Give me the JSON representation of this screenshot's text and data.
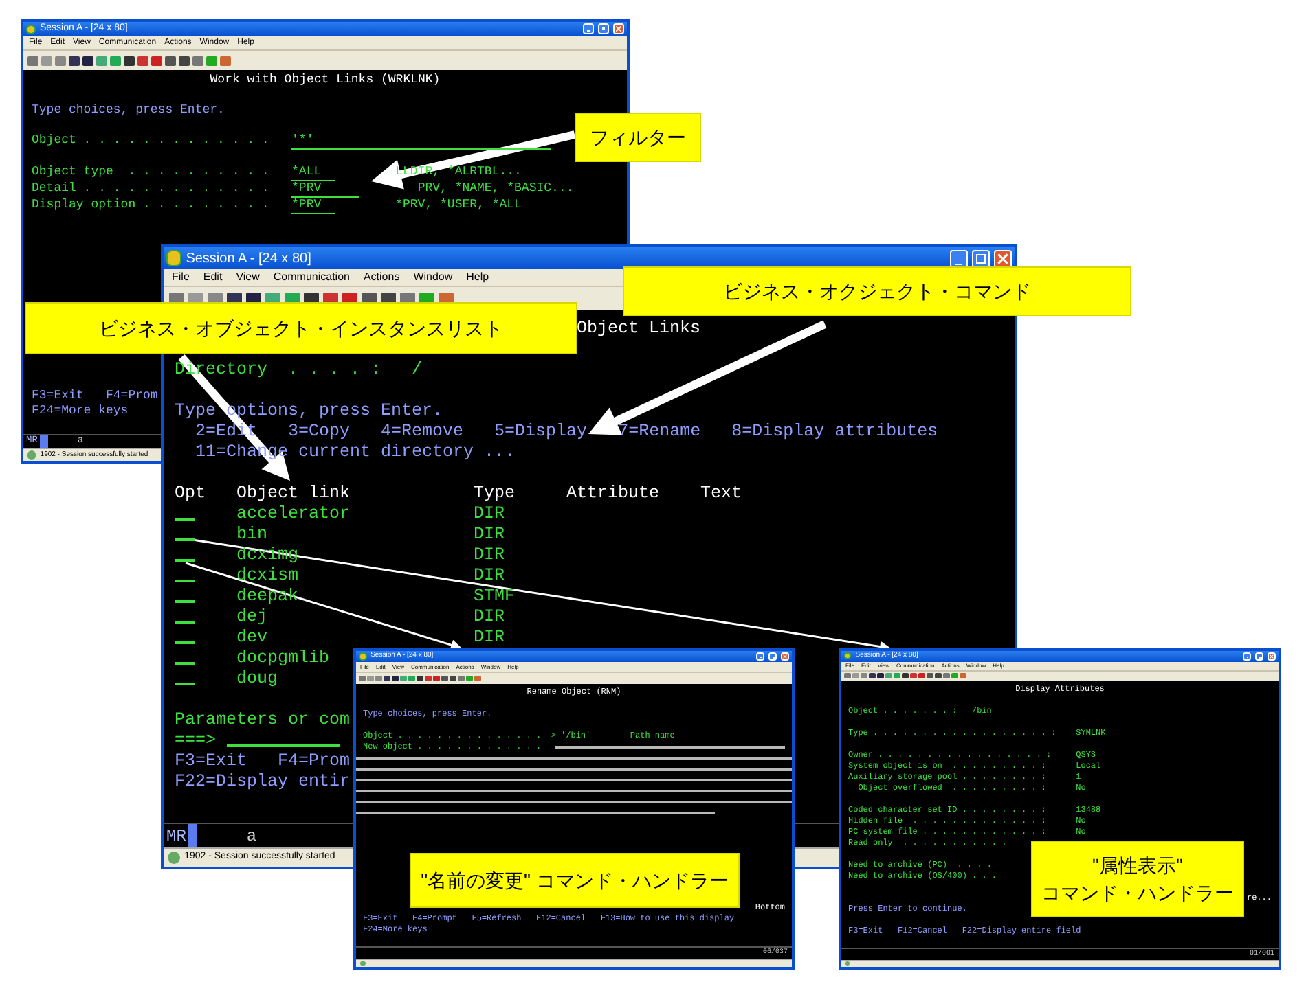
{
  "windows": [
    {
      "kind": "prompt",
      "title": "Session A - [24 x 80]",
      "menu": [
        "File",
        "Edit",
        "View",
        "Communication",
        "Actions",
        "Window",
        "Help"
      ],
      "heading": "Work with Object Links (WRKLNK)",
      "instruction": "Type choices, press Enter.",
      "fields": [
        {
          "label": "Object . . . . . . . . . . . . .",
          "value": "'*'"
        },
        {
          "label": "Object type  . . . . . . . . . .",
          "value": "*ALL",
          "choices": "LLDIR, *ALRTBL..."
        },
        {
          "label": "Detail . . . . . . . . . . . . .",
          "value": "*PRV",
          "choices": "PRV, *NAME, *BASIC..."
        },
        {
          "label": "Display option . . . . . . . . .",
          "value": "*PRV",
          "choices": "*PRV, *USER, *ALL"
        }
      ],
      "function_keys": [
        "F3=Exit   F4=Prom",
        "F24=More keys"
      ],
      "status": {
        "mode": "MR",
        "field": "a",
        "message": "1902 - Session successfully started"
      }
    },
    {
      "kind": "list",
      "title": "Session A - [24 x 80]",
      "menu": [
        "File",
        "Edit",
        "View",
        "Communication",
        "Actions",
        "Window",
        "Help"
      ],
      "heading": "Object Links",
      "directory": {
        "label": "Directory  . . . . :",
        "value": "/"
      },
      "instruction": "Type options, press Enter.",
      "options": [
        "2=Edit",
        "3=Copy",
        "4=Remove",
        "5=Display",
        "7=Rename",
        "8=Display attributes"
      ],
      "options_line2": "11=Change current directory ...",
      "columns": [
        "Opt",
        "Object link",
        "Type",
        "Attribute",
        "Text"
      ],
      "rows": [
        {
          "name": "accelerator",
          "type": "DIR"
        },
        {
          "name": "bin",
          "type": "DIR"
        },
        {
          "name": "dcximg",
          "type": "DIR"
        },
        {
          "name": "dcxism",
          "type": "DIR"
        },
        {
          "name": "deepak",
          "type": "STMF"
        },
        {
          "name": "dej",
          "type": "DIR"
        },
        {
          "name": "dev",
          "type": "DIR"
        },
        {
          "name": "docpgmlib"
        },
        {
          "name": "doug"
        }
      ],
      "command_label": "Parameters or com",
      "prompt": "===>",
      "function_keys": [
        "F3=Exit   F4=Prom",
        "F22=Display entir"
      ],
      "status": {
        "mode": "MR",
        "field": "a",
        "message": "1902 - Session successfully started"
      }
    },
    {
      "kind": "rename",
      "title": "Session A - [24 x 80]",
      "menu": [
        "File",
        "Edit",
        "View",
        "Communication",
        "Actions",
        "Window",
        "Help"
      ],
      "heading": "Rename Object (RNM)",
      "instruction": "Type choices, press Enter.",
      "fields": [
        {
          "label": "Object . . . . . . . . . . . . . . .",
          "value": "> '/bin'",
          "note": "Path name"
        },
        {
          "label": "New object . . . . . . . . . . . . ."
        }
      ],
      "bottom": "Bottom",
      "function_keys": [
        "F3=Exit   F4=Prompt   F5=Refresh   F12=Cancel   F13=How to use this display",
        "F24=More keys"
      ],
      "status": {
        "position": "06/037"
      }
    },
    {
      "kind": "attributes",
      "title": "Session A - [24 x 80]",
      "menu": [
        "File",
        "Edit",
        "View",
        "Communication",
        "Actions",
        "Window",
        "Help"
      ],
      "heading": "Display Attributes",
      "object": {
        "label": "Object . . . . . . . :",
        "value": "/bin"
      },
      "attribute_groups": [
        [
          {
            "label": "Type . . . . . . . . . . . . . . . . . . :",
            "value": "SYMLNK"
          }
        ],
        [
          {
            "label": "Owner . . . . . . . . . . . . . . . . . :",
            "value": "QSYS"
          },
          {
            "label": "System object is on  . . . . . . . . . :",
            "value": "Local"
          },
          {
            "label": "Auxiliary storage pool . . . . . . . . :",
            "value": "1"
          },
          {
            "label": "  Object overflowed  . . . . . . . . . :",
            "value": "No"
          }
        ],
        [
          {
            "label": "Coded character set ID . . . . . . . . :",
            "value": "13488"
          },
          {
            "label": "Hidden file  . . . . . . . . . . . . . :",
            "value": "No"
          },
          {
            "label": "PC system file . . . . . . . . . . . . :",
            "value": "No"
          },
          {
            "label": "Read only  . . . . . . . . . . ."
          }
        ],
        [
          {
            "label": "Need to archive (PC)  . . . ."
          },
          {
            "label": "Need to archive (OS/400) . . ."
          }
        ]
      ],
      "more": "re...",
      "instruction": "Press Enter to continue.",
      "function_keys": [
        "F3=Exit   F12=Cancel   F22=Display entire field"
      ],
      "status": {
        "position": "01/001"
      }
    }
  ],
  "callouts": [
    {
      "lines": [
        "フィルター"
      ]
    },
    {
      "lines": [
        "ビジネス・オブジェクト・インスタンスリスト"
      ]
    },
    {
      "lines": [
        "ビジネス・オクジェクト・コマンド"
      ]
    },
    {
      "lines": [
        "\"名前の変更\" コマンド・ハンドラー"
      ]
    },
    {
      "lines": [
        "\"属性表示\"",
        "コマンド・ハンドラー"
      ]
    }
  ]
}
